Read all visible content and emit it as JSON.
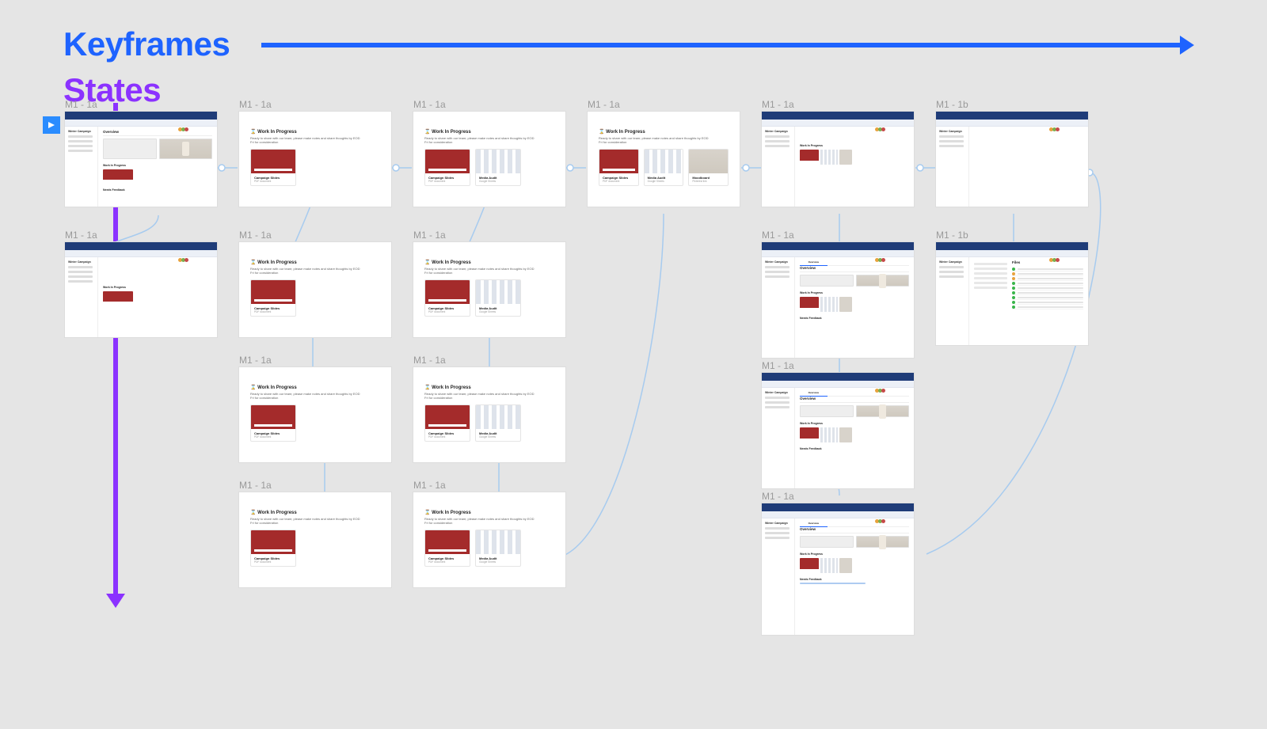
{
  "axis": {
    "keyframes": "Keyframes",
    "states": "States"
  },
  "cardContent": {
    "sidebarTitle": "Winter Campaign",
    "overview": "Overview",
    "files": "Files",
    "wipHeading": "Work In Progress",
    "wipDesc1": "Ready to share with our team; please make notes and share thoughts by EOD",
    "wipDesc2": "Fri for consideration",
    "sectionNeeds": "Needs Feedback",
    "file1": {
      "name": "Campaign Slides",
      "sub": "PDF document"
    },
    "file2": {
      "name": "Media Audit",
      "sub": "Google Sheets"
    },
    "file3": {
      "name": "Moodboard",
      "sub": "Pinterest link"
    }
  },
  "frames": {
    "c1": [
      {
        "label": "M1 - 1a",
        "type": "A-overview"
      },
      {
        "label": "M1 - 1a",
        "type": "A-plain"
      }
    ],
    "c2": [
      {
        "label": "M1 - 1a",
        "type": "B-1"
      },
      {
        "label": "M1 - 1a",
        "type": "B-1b"
      },
      {
        "label": "M1 - 1a",
        "type": "B-1b"
      },
      {
        "label": "M1 - 1a",
        "type": "B-1b"
      }
    ],
    "c3": [
      {
        "label": "M1 - 1a",
        "type": "B-2"
      },
      {
        "label": "M1 - 1a",
        "type": "B-2"
      },
      {
        "label": "M1 - 1a",
        "type": "B-2"
      },
      {
        "label": "M1 - 1a",
        "type": "B-2"
      }
    ],
    "c4": [
      {
        "label": "M1 - 1a",
        "type": "B-3"
      }
    ],
    "c5": [
      {
        "label": "M1 - 1a",
        "type": "A-large"
      },
      {
        "label": "M1 - 1a",
        "type": "A-large"
      },
      {
        "label": "M1 - 1a",
        "type": "A-large"
      },
      {
        "label": "M1 - 1a",
        "type": "A-large"
      }
    ],
    "c6": [
      {
        "label": "M1 - 1b",
        "type": "A-empty"
      },
      {
        "label": "M1 - 1b",
        "type": "C-files"
      }
    ]
  }
}
